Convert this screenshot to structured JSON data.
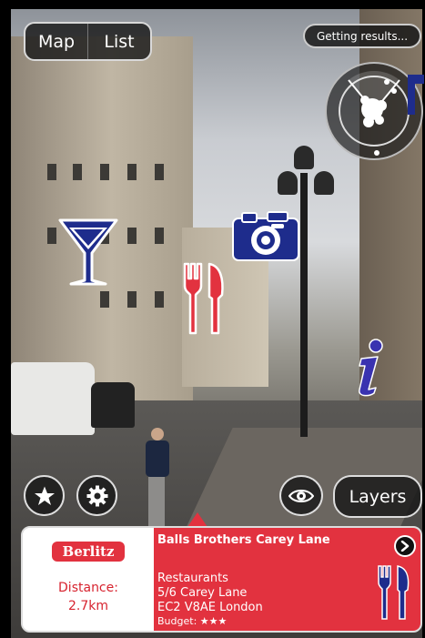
{
  "top_bar": {
    "view_toggle": [
      {
        "label": "Map"
      },
      {
        "label": "List"
      }
    ],
    "status": "Getting results..."
  },
  "radar": {
    "icon": "radar-icon"
  },
  "poi_markers": [
    {
      "name": "bar",
      "icon": "cocktail-glass-icon",
      "color": "#1e2c8c"
    },
    {
      "name": "restaurant",
      "icon": "fork-knife-icon",
      "color": "#e2323f"
    },
    {
      "name": "sight",
      "icon": "camera-icon",
      "color": "#1e2c8c"
    },
    {
      "name": "info",
      "icon": "info-icon",
      "color": "#3a33b0"
    }
  ],
  "bottom_controls": {
    "favorites_icon": "star-icon",
    "settings_icon": "gear-icon",
    "visibility_icon": "eye-icon",
    "layers_label": "Layers"
  },
  "info_card": {
    "brand": "Berlitz",
    "distance_label": "Distance:",
    "distance_value": "2.7km",
    "title": "Balls Brothers Carey Lane",
    "category": "Restaurants",
    "address_line1": "5/6 Carey Lane",
    "address_line2": "EC2 V8AE London",
    "budget": "Budget: ★★★",
    "detail_icon": "chevron-right-icon",
    "category_icon": "fork-knife-icon"
  },
  "colors": {
    "card_accent": "#e2323f",
    "marker_blue": "#1e2c8c"
  }
}
